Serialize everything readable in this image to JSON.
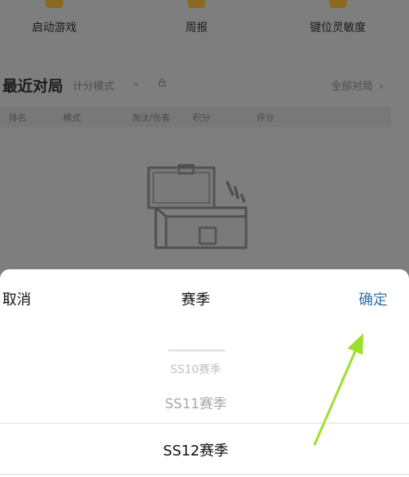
{
  "top_actions": [
    {
      "label": "启动游戏",
      "icon": "launch-game-icon"
    },
    {
      "label": "周报",
      "icon": "weekly-report-icon"
    },
    {
      "label": "键位灵敏度",
      "icon": "key-sensitivity-icon"
    }
  ],
  "recent": {
    "title": "最近对局",
    "mode": "计分模式",
    "all_link": "全部对局",
    "columns": [
      "排名",
      "模式",
      "淘汰/伤害",
      "积分",
      "评分"
    ]
  },
  "picker": {
    "cancel": "取消",
    "title": "赛季",
    "confirm": "确定",
    "options": [
      "SS10赛季",
      "SS11赛季",
      "SS12赛季"
    ],
    "selected": "SS12赛季"
  },
  "colors": {
    "confirm": "#2f6fa7",
    "annotation_arrow": "#9be02a"
  }
}
